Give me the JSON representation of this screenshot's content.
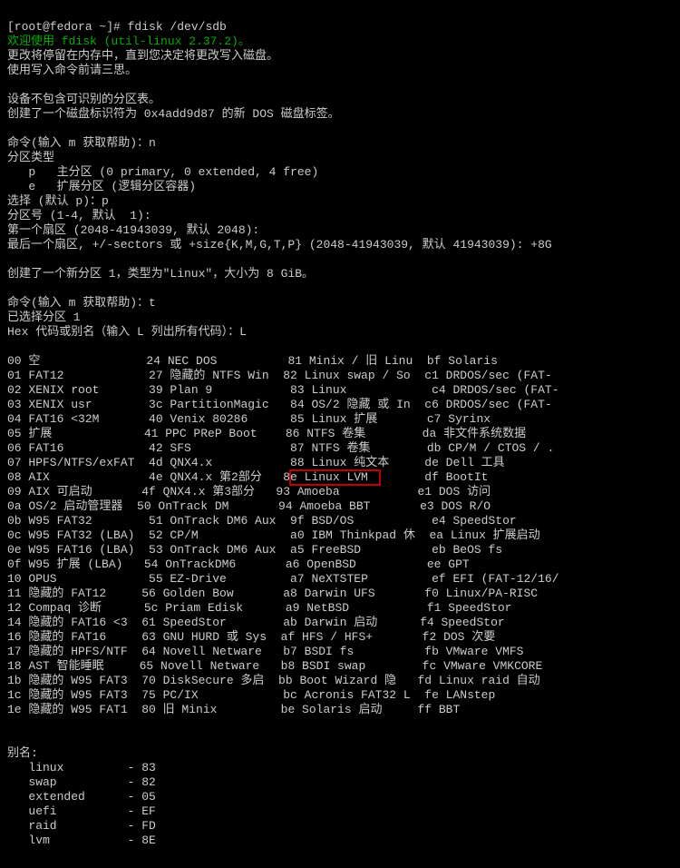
{
  "prompt": "[root@fedora ~]# ",
  "cmd_fdisk": "fdisk /dev/sdb",
  "welcome": "欢迎使用 fdisk (util-linux 2.37.2)。",
  "msg_buffer": "更改将停留在内存中，直到您决定将更改写入磁盘。",
  "msg_care": "使用写入命令前请三思。",
  "msg_no_table": "设备不包含可识别的分区表。",
  "msg_new_label": "创建了一个磁盘标识符为 0x4add9d87 的新 DOS 磁盘标签。",
  "cmd_prompt": "命令(输入 m 获取帮助)：",
  "cmd_n": "n",
  "part_type_hdr": "分区类型",
  "part_p_line": "   p   主分区 (0 primary, 0 extended, 4 free)",
  "part_e_line": "   e   扩展分区 (逻辑分区容器)",
  "select_default_p": "选择 (默认 p)：p",
  "part_num": "分区号 (1-4, 默认  1):",
  "first_sector": "第一个扇区 (2048-41943039, 默认 2048):",
  "last_sector": "最后一个扇区, +/-sectors 或 +size{K,M,G,T,P} (2048-41943039, 默认 41943039): +8G",
  "created_part": "创建了一个新分区 1，类型为\"Linux\"，大小为 8 GiB。",
  "cmd_t": "t",
  "selected_part": "已选择分区 1",
  "hex_prompt": "Hex 代码或别名（输入 L 列出所有代码）：L",
  "codes": [
    [
      "00",
      "空",
      "24",
      "NEC DOS",
      "81",
      "Minix / 旧 Linu",
      "bf",
      "Solaris"
    ],
    [
      "01",
      "FAT12",
      "27",
      "隐藏的 NTFS Win",
      "82",
      "Linux swap / So",
      "c1",
      "DRDOS/sec (FAT-"
    ],
    [
      "02",
      "XENIX root",
      "39",
      "Plan 9",
      "83",
      "Linux",
      "c4",
      "DRDOS/sec (FAT-"
    ],
    [
      "03",
      "XENIX usr",
      "3c",
      "PartitionMagic",
      "84",
      "OS/2 隐藏 或 In",
      "c6",
      "DRDOS/sec (FAT-"
    ],
    [
      "04",
      "FAT16 <32M",
      "40",
      "Venix 80286",
      "85",
      "Linux 扩展",
      "c7",
      "Syrinx"
    ],
    [
      "05",
      "扩展",
      "41",
      "PPC PReP Boot",
      "86",
      "NTFS 卷集",
      "da",
      "非文件系统数据"
    ],
    [
      "06",
      "FAT16",
      "42",
      "SFS",
      "87",
      "NTFS 卷集",
      "db",
      "CP/M / CTOS / ."
    ],
    [
      "07",
      "HPFS/NTFS/exFAT",
      "4d",
      "QNX4.x",
      "88",
      "Linux 纯文本",
      "de",
      "Dell 工具"
    ],
    [
      "08",
      "AIX",
      "4e",
      "QNX4.x 第2部分",
      "8e",
      "Linux LVM",
      "df",
      "BootIt"
    ],
    [
      "09",
      "AIX 可启动",
      "4f",
      "QNX4.x 第3部分",
      "93",
      "Amoeba",
      "e1",
      "DOS 访问"
    ],
    [
      "0a",
      "OS/2 启动管理器",
      "50",
      "OnTrack DM",
      "94",
      "Amoeba BBT",
      "e3",
      "DOS R/O"
    ],
    [
      "0b",
      "W95 FAT32",
      "51",
      "OnTrack DM6 Aux",
      "9f",
      "BSD/OS",
      "e4",
      "SpeedStor"
    ],
    [
      "0c",
      "W95 FAT32 (LBA)",
      "52",
      "CP/M",
      "a0",
      "IBM Thinkpad 休",
      "ea",
      "Linux 扩展启动"
    ],
    [
      "0e",
      "W95 FAT16 (LBA)",
      "53",
      "OnTrack DM6 Aux",
      "a5",
      "FreeBSD",
      "eb",
      "BeOS fs"
    ],
    [
      "0f",
      "W95 扩展 (LBA)",
      "54",
      "OnTrackDM6",
      "a6",
      "OpenBSD",
      "ee",
      "GPT"
    ],
    [
      "10",
      "OPUS",
      "55",
      "EZ-Drive",
      "a7",
      "NeXTSTEP",
      "ef",
      "EFI (FAT-12/16/"
    ],
    [
      "11",
      "隐藏的 FAT12",
      "56",
      "Golden Bow",
      "a8",
      "Darwin UFS",
      "f0",
      "Linux/PA-RISC"
    ],
    [
      "12",
      "Compaq 诊断",
      "5c",
      "Priam Edisk",
      "a9",
      "NetBSD",
      "f1",
      "SpeedStor"
    ],
    [
      "14",
      "隐藏的 FAT16 <3",
      "61",
      "SpeedStor",
      "ab",
      "Darwin 启动",
      "f4",
      "SpeedStor"
    ],
    [
      "16",
      "隐藏的 FAT16",
      "63",
      "GNU HURD 或 Sys",
      "af",
      "HFS / HFS+",
      "f2",
      "DOS 次要"
    ],
    [
      "17",
      "隐藏的 HPFS/NTF",
      "64",
      "Novell Netware",
      "b7",
      "BSDI fs",
      "fb",
      "VMware VMFS"
    ],
    [
      "18",
      "AST 智能睡眠",
      "65",
      "Novell Netware",
      "b8",
      "BSDI swap",
      "fc",
      "VMware VMKCORE"
    ],
    [
      "1b",
      "隐藏的 W95 FAT3",
      "70",
      "DiskSecure 多启",
      "bb",
      "Boot Wizard 隐",
      "fd",
      "Linux raid 自动"
    ],
    [
      "1c",
      "隐藏的 W95 FAT3",
      "75",
      "PC/IX",
      "bc",
      "Acronis FAT32 L",
      "fe",
      "LANstep"
    ],
    [
      "1e",
      "隐藏的 W95 FAT1",
      "80",
      "旧 Minix",
      "be",
      "Solaris 启动",
      "ff",
      "BBT"
    ]
  ],
  "alias_hdr": "别名:",
  "aliases": [
    [
      "linux",
      "83"
    ],
    [
      "swap",
      "82"
    ],
    [
      "extended",
      "05"
    ],
    [
      "uefi",
      "EF"
    ],
    [
      "raid",
      "FD"
    ],
    [
      "lvm",
      "8E"
    ]
  ],
  "highlight_code": "8e",
  "chart_data": null
}
